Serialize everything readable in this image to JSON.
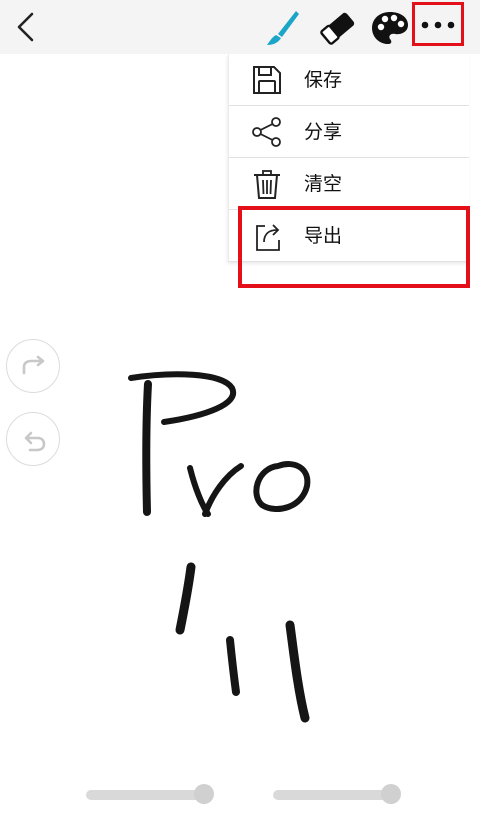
{
  "toolbar": {
    "back_icon": "chevron-left-icon",
    "tools": [
      "brush-icon",
      "eraser-icon",
      "palette-icon",
      "more-dots-icon"
    ],
    "brush_color": "#1aa6c8"
  },
  "menu": {
    "items": [
      {
        "label": "保存",
        "icon": "floppy-disk-icon"
      },
      {
        "label": "分享",
        "icon": "share-icon"
      },
      {
        "label": "清空",
        "icon": "trash-icon"
      },
      {
        "label": "导出",
        "icon": "export-icon"
      }
    ]
  },
  "side_buttons": [
    "redo-icon",
    "undo-icon"
  ],
  "highlight_color": "#e3101a"
}
